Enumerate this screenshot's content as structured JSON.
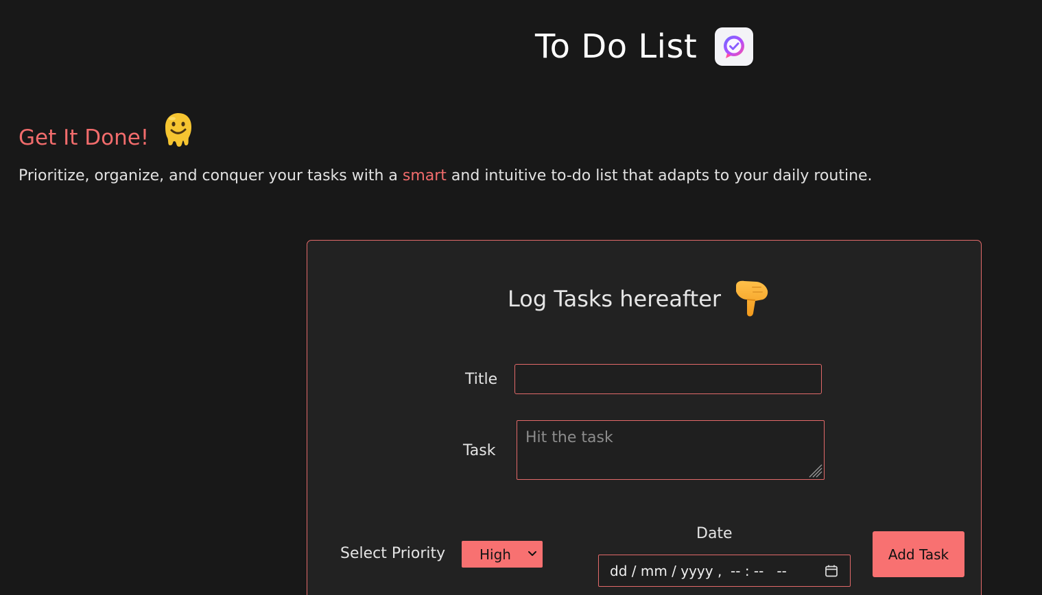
{
  "header": {
    "title": "To Do List",
    "logo_icon": "check-chat-icon"
  },
  "hero": {
    "title": "Get It Done!",
    "emoji_icon": "melting-face-icon",
    "tagline_before": "Prioritize, organize, and conquer your tasks with a ",
    "tagline_accent": "smart",
    "tagline_after": " and intuitive to-do list that adapts to your daily routine."
  },
  "form": {
    "heading": "Log Tasks hereafter",
    "heading_icon": "pointing-down-hand-icon",
    "title_label": "Title",
    "title_value": "",
    "task_label": "Task",
    "task_placeholder": "Hit the task",
    "priority_label": "Select Priority",
    "priority_value": "High",
    "date_label": "Date",
    "date_placeholder": "dd / mm / yyyy ,  -- : --   --",
    "add_button": "Add Task"
  },
  "colors": {
    "background": "#181818",
    "card": "#222222",
    "accent": "#f26c6c",
    "button": "#f87171",
    "border": "#e46a6a"
  }
}
